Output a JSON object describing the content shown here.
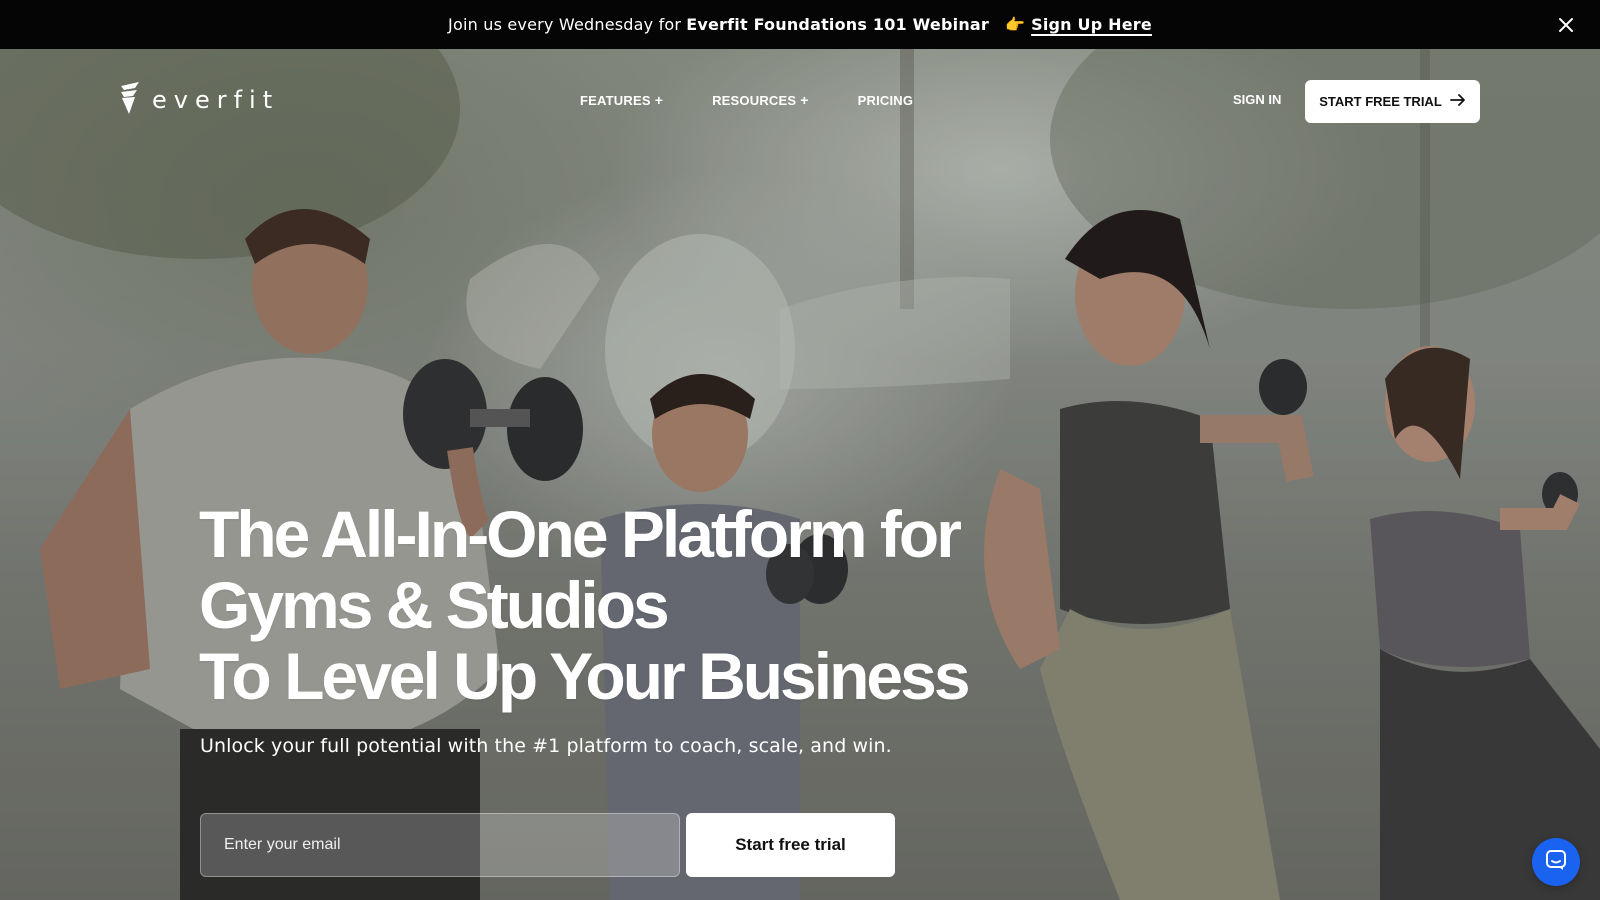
{
  "announcement": {
    "prefix": "Join us every Wednesday for",
    "event": "Everfit Foundations 101 Webinar",
    "hand_emoji": "👉",
    "link": "Sign Up Here",
    "close_icon": "close-icon"
  },
  "brand": {
    "name": "everfit",
    "logo_icon": "everfit-logo-icon"
  },
  "nav": {
    "items": [
      {
        "label": "FEATURES",
        "has_submenu": true
      },
      {
        "label": "RESOURCES",
        "has_submenu": true
      },
      {
        "label": "PRICING",
        "has_submenu": false
      }
    ],
    "sign_in": "SIGN IN",
    "trial_button": "START FREE TRIAL",
    "arrow_icon": "arrow-right-icon"
  },
  "hero": {
    "headline_lines": [
      "The All-In-One Platform for",
      "Gyms & Studios",
      "To Level Up Your Business"
    ],
    "subheadline": "Unlock your full potential with the #1 platform to coach, scale, and win.",
    "email_placeholder": "Enter your email",
    "email_value": "",
    "cta_label": "Start free trial"
  },
  "chat_widget": {
    "icon": "chat-icon",
    "color": "#1a63f0"
  },
  "colors": {
    "announcement_bg": "#050505",
    "text_on_hero": "#ffffff",
    "button_bg": "#ffffff"
  }
}
